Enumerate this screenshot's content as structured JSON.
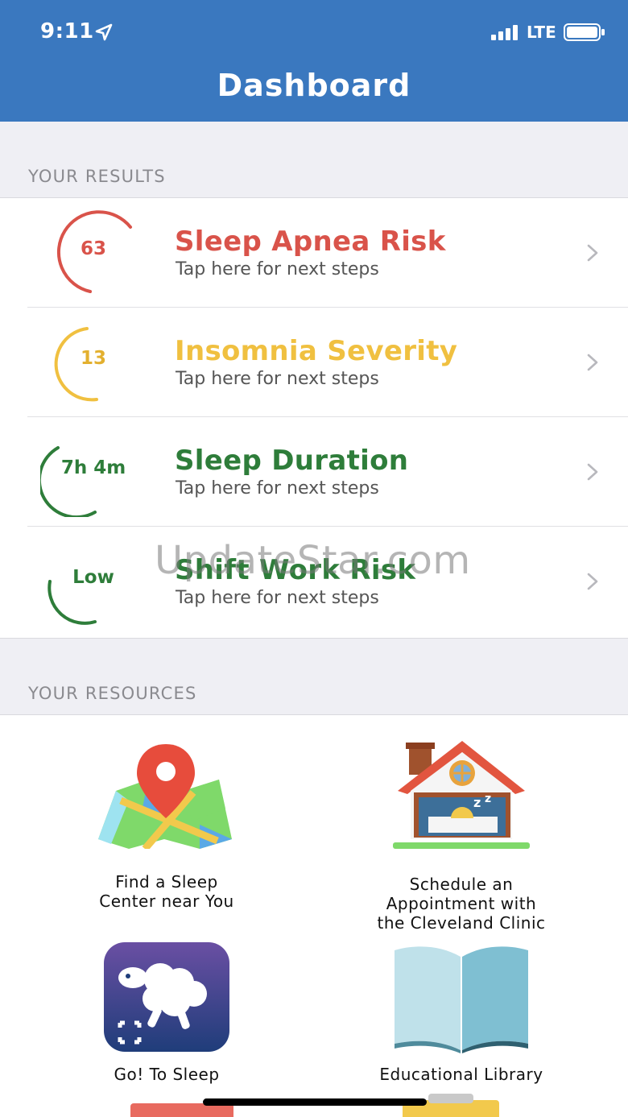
{
  "status_bar": {
    "time": "9:11",
    "network": "LTE"
  },
  "header": {
    "title": "Dashboard"
  },
  "results_section": {
    "label": "YOUR RESULTS"
  },
  "results": [
    {
      "value": "63",
      "title": "Sleep Apnea Risk",
      "subtitle": "Tap here for next steps",
      "color": "#d9534a"
    },
    {
      "value": "13",
      "title": "Insomnia Severity",
      "subtitle": "Tap here for next steps",
      "color": "#f0c040"
    },
    {
      "value": "7h 4m",
      "title": "Sleep Duration",
      "subtitle": "Tap here for next steps",
      "color": "#2e7d3a"
    },
    {
      "value": "Low",
      "title": "Shift Work Risk",
      "subtitle": "Tap here for next steps",
      "color": "#2e7d3a"
    }
  ],
  "watermark": "UpdateStar.com",
  "resources_section": {
    "label": "YOUR RESOURCES"
  },
  "resources": [
    {
      "label_line1": "Find a Sleep",
      "label_line2": "Center near You",
      "icon": "map-pin-icon"
    },
    {
      "label_line1": "Schedule an",
      "label_line2": "Appointment with",
      "label_line3": "the Cleveland Clinic",
      "icon": "sleeping-house-icon"
    },
    {
      "label_line1": "Go! To Sleep",
      "icon": "sheep-app-icon"
    },
    {
      "label_line1": "Educational Library",
      "icon": "open-book-icon"
    }
  ]
}
